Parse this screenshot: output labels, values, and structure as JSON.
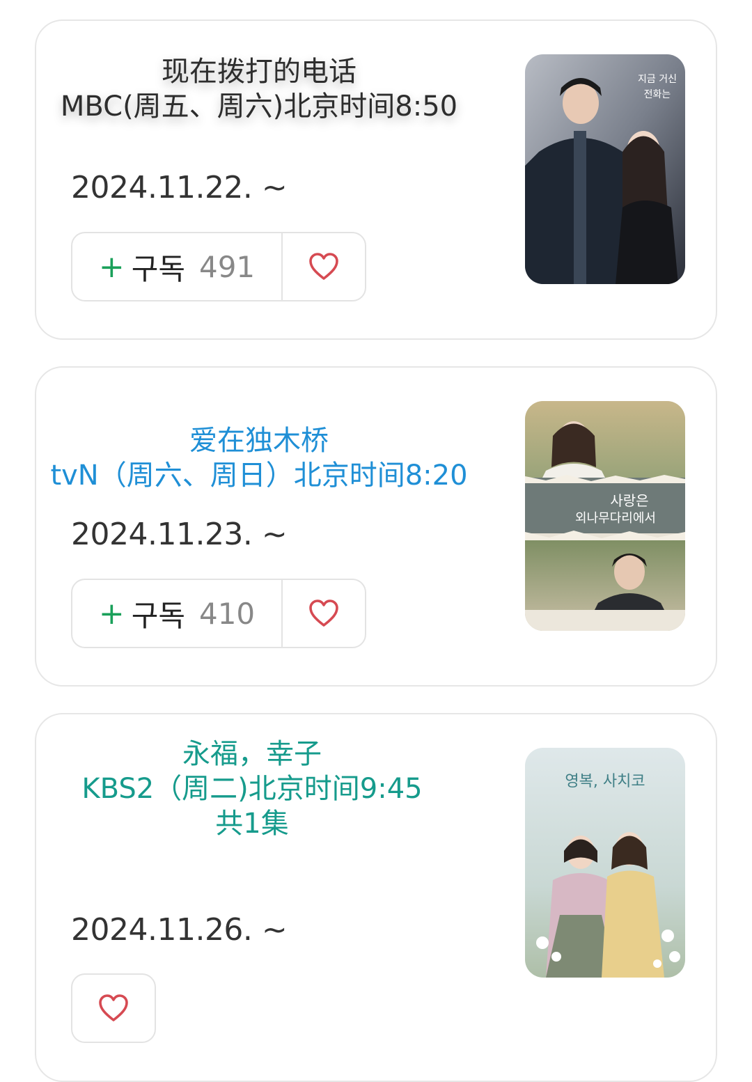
{
  "dramas": [
    {
      "title_lines": [
        "现在拨打的电话",
        "MBC(周五、周六)北京时间8:50"
      ],
      "date": "2024.11.22. ~",
      "subscribe": {
        "plus": "+",
        "label": "구독",
        "count": "491"
      },
      "poster": {
        "icon": "poster-image",
        "text_lines": [
          "지금 거신",
          "전화는"
        ]
      },
      "title_color": "#2d2d2d"
    },
    {
      "title_lines": [
        "爱在独木桥",
        "tvN（周六、周日）北京时间8:20"
      ],
      "date": "2024.11.23. ~",
      "subscribe": {
        "plus": "+",
        "label": "구독",
        "count": "410"
      },
      "poster": {
        "icon": "poster-image",
        "text_lines": [
          "사랑은",
          "외나무다리에서"
        ]
      },
      "title_color": "#1f8fd6"
    },
    {
      "title_lines": [
        "永福，幸子",
        "KBS2（周二)北京时间9:45",
        "共1集"
      ],
      "date": "2024.11.26. ~",
      "poster": {
        "icon": "poster-image",
        "text_lines": [
          "영복, 사치코"
        ]
      },
      "title_color": "#169b8c"
    }
  ],
  "icons": {
    "like": "heart-icon",
    "plus": "plus-icon"
  }
}
